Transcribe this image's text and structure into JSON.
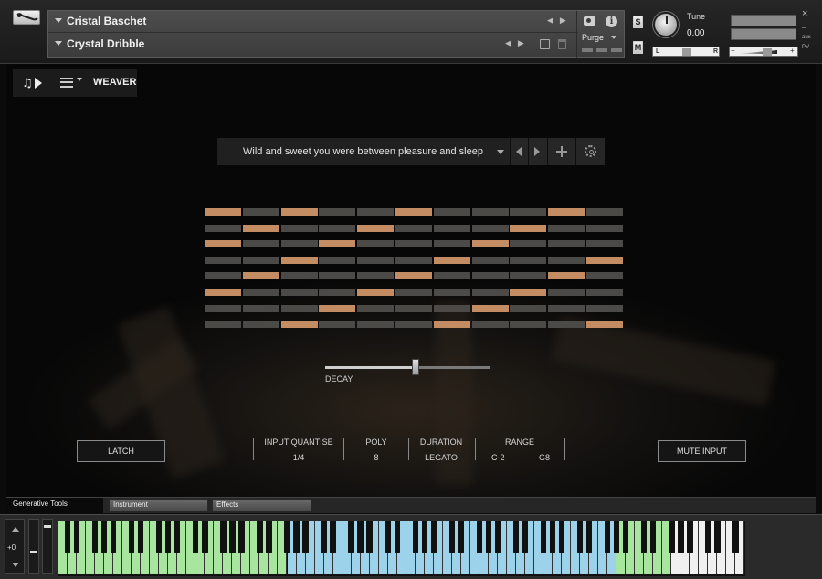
{
  "header": {
    "instrument_title": "Cristal Baschet",
    "preset_name": "Crystal Dribble",
    "purge_label": "Purge",
    "solo_label": "S",
    "mute_label": "M",
    "tune_label": "Tune",
    "tune_value": "0.00",
    "pan_left": "L",
    "pan_right": "R",
    "vol_minus": "−",
    "vol_plus": "+",
    "close_glyph": "×",
    "aux_label": "aux",
    "pv_label": "PV",
    "info_glyph": "i"
  },
  "mode": {
    "label": "WEAVER",
    "note_glyph": "♫"
  },
  "preset_bar": {
    "name": "Wild and sweet you were between pleasure and sleep"
  },
  "sequencer": {
    "active_columns": [
      [
        0,
        2,
        5,
        9
      ],
      [
        1,
        4,
        8
      ],
      [
        0,
        3,
        7
      ],
      [
        2,
        6,
        10
      ],
      [
        1,
        5,
        9
      ],
      [
        0,
        4,
        8
      ],
      [
        3,
        7
      ],
      [
        2,
        6,
        10
      ]
    ]
  },
  "decay": {
    "label": "DECAY",
    "value": 0.55
  },
  "controls": {
    "latch_label": "LATCH",
    "mute_input_label": "MUTE INPUT",
    "input_quantise_label": "INPUT QUANTISE",
    "input_quantise_value": "1/4",
    "poly_label": "POLY",
    "poly_value": "8",
    "duration_label": "DURATION",
    "duration_value": "LEGATO",
    "range_label": "RANGE",
    "range_low": "C-2",
    "range_high": "G8"
  },
  "tabs": {
    "active": "Generative Tools",
    "instrument": "Instrument",
    "effects": "Effects"
  },
  "keyboard": {
    "octave_value": "+0",
    "colors": {
      "green": "#a8e6a0",
      "blue": "#9dd3ea",
      "white": "#f0f0f0"
    },
    "green_low_range": [
      0,
      25
    ],
    "blue_range": [
      25,
      61
    ],
    "green_high_range": [
      61,
      67
    ]
  }
}
